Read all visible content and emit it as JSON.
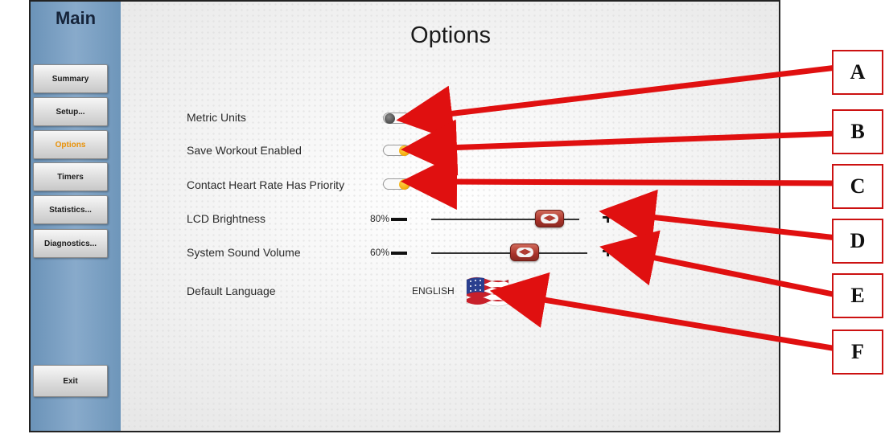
{
  "sidebar": {
    "title": "Main",
    "items": [
      {
        "label": "Summary",
        "active": false
      },
      {
        "label": "Setup...",
        "active": false
      },
      {
        "label": "Options",
        "active": true
      },
      {
        "label": "Timers",
        "active": false
      },
      {
        "label": "Statistics...",
        "active": false
      },
      {
        "label": "Diagnostics...",
        "active": false
      }
    ],
    "exit_label": "Exit"
  },
  "main": {
    "title": "Options",
    "settings": {
      "metric_units": {
        "label": "Metric Units",
        "enabled": false
      },
      "save_workout": {
        "label": "Save Workout Enabled",
        "enabled": true
      },
      "contact_hr": {
        "label": "Contact Heart Rate Has Priority",
        "enabled": true
      },
      "lcd_brightness": {
        "label": "LCD Brightness",
        "value_text": "80%",
        "value": 0.8
      },
      "sound_volume": {
        "label": "System Sound Volume",
        "value_text": "60%",
        "value": 0.6
      },
      "language": {
        "label": "Default Language",
        "value": "ENGLISH",
        "flag_icon": "us-flag-icon"
      }
    }
  },
  "annotations": {
    "letters": [
      "A",
      "B",
      "C",
      "D",
      "E",
      "F"
    ],
    "color": "#e01010"
  },
  "colors": {
    "sidebar": "#7aa0c4",
    "active_nav": "#e8920a",
    "toggle_on": "#f5a800",
    "slider_thumb": "#a8322a"
  }
}
